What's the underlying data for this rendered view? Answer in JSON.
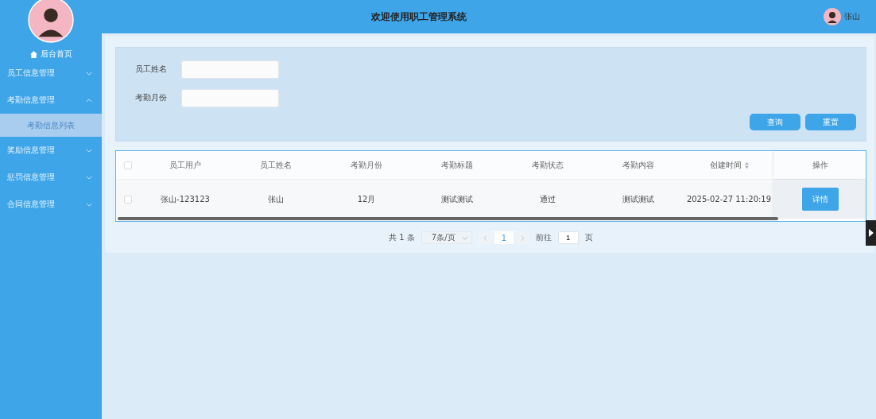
{
  "sidebar": {
    "home_link": "后台首页",
    "menus": [
      {
        "label": "员工信息管理",
        "expanded": false
      },
      {
        "label": "考勤信息管理",
        "expanded": true,
        "children": [
          {
            "label": "考勤信息列表",
            "selected": true
          }
        ]
      },
      {
        "label": "奖励信息管理",
        "expanded": false
      },
      {
        "label": "惩罚信息管理",
        "expanded": false
      },
      {
        "label": "合同信息管理",
        "expanded": false
      }
    ]
  },
  "header": {
    "title": "欢迎使用职工管理系统",
    "user_name": "张山"
  },
  "search": {
    "fields": [
      {
        "label": "员工姓名"
      },
      {
        "label": "考勤月份"
      }
    ],
    "buttons": [
      "查询",
      "重置"
    ]
  },
  "table": {
    "select_all_checked": false,
    "columns": [
      {
        "label": "员工用户",
        "sortable": false
      },
      {
        "label": "员工姓名",
        "sortable": false
      },
      {
        "label": "考勤月份",
        "sortable": false
      },
      {
        "label": "考勤标题",
        "sortable": false
      },
      {
        "label": "考勤状态",
        "sortable": false
      },
      {
        "label": "考勤内容",
        "sortable": false
      },
      {
        "label": "创建时间",
        "sortable": true
      },
      {
        "label": "操作",
        "sortable": false
      }
    ],
    "rows": [
      {
        "checked": false,
        "cells": [
          "张山-123123",
          "张山",
          "12月",
          "测试测试",
          "通过",
          "测试测试",
          "2025-02-27 11:20:19"
        ],
        "action": "详情"
      }
    ]
  },
  "pagination": {
    "total": "共 1 条",
    "page_size": "7条/页",
    "pages": [
      {
        "label": "1",
        "selected": true
      }
    ],
    "goto_label": "前往",
    "goto_value": "1",
    "goto_suffix": "页"
  }
}
